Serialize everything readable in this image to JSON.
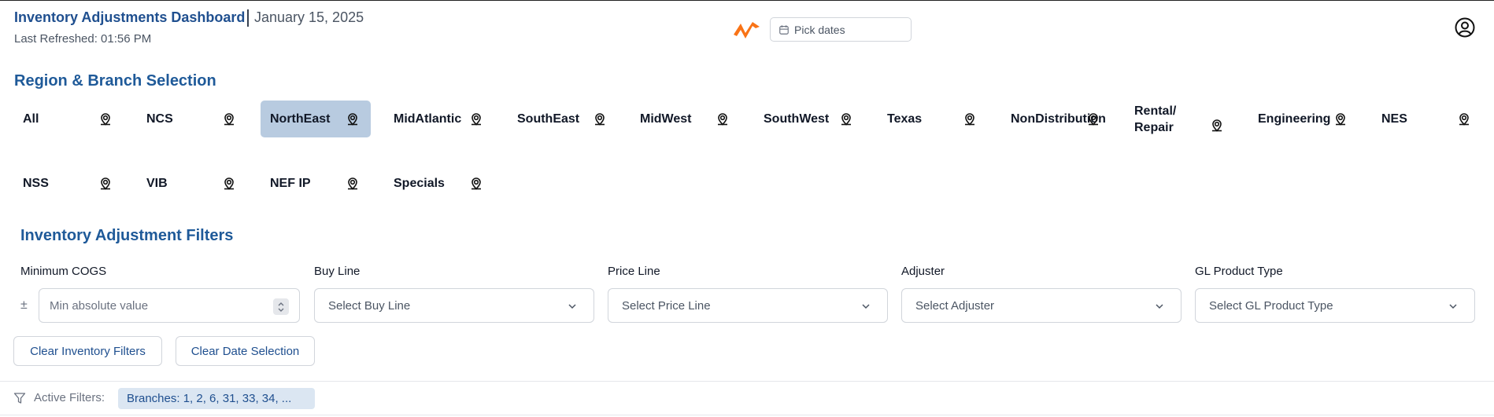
{
  "header": {
    "title": "Inventory Adjustments Dashboard",
    "date": "January 15, 2025",
    "last_refreshed": "Last Refreshed: 01:56 PM",
    "date_picker_placeholder": "Pick dates"
  },
  "regions": {
    "title": "Region & Branch Selection",
    "selected": "NorthEast",
    "items": [
      {
        "label": "All"
      },
      {
        "label": "NCS"
      },
      {
        "label": "NorthEast"
      },
      {
        "label": "MidAtlantic"
      },
      {
        "label": "SouthEast"
      },
      {
        "label": "MidWest"
      },
      {
        "label": "SouthWest"
      },
      {
        "label": "Texas"
      },
      {
        "label": "NonDistribution"
      },
      {
        "label": "Rental/ Repair"
      },
      {
        "label": "Engineering"
      },
      {
        "label": "NES"
      },
      {
        "label": "NSS"
      },
      {
        "label": "VIB"
      },
      {
        "label": "NEF IP"
      },
      {
        "label": "Specials"
      }
    ]
  },
  "filters": {
    "title": "Inventory Adjustment Filters",
    "min_cogs": {
      "label": "Minimum COGS",
      "prefix": "±",
      "placeholder": "Min absolute value"
    },
    "buy_line": {
      "label": "Buy Line",
      "placeholder": "Select Buy Line"
    },
    "price_line": {
      "label": "Price Line",
      "placeholder": "Select Price Line"
    },
    "adjuster": {
      "label": "Adjuster",
      "placeholder": "Select Adjuster"
    },
    "gl_product_type": {
      "label": "GL Product Type",
      "placeholder": "Select GL Product Type"
    },
    "clear_inventory_label": "Clear Inventory Filters",
    "clear_date_label": "Clear Date Selection"
  },
  "active_filters": {
    "label": "Active Filters:",
    "chips": [
      "Branches: 1, 2, 6, 31, 33, 34, ..."
    ]
  },
  "colors": {
    "title_blue": "#1f4f8f",
    "selected_bg": "#b8cbe0",
    "chip_bg": "#dbe6f2",
    "logo_orange": "#f97316"
  }
}
